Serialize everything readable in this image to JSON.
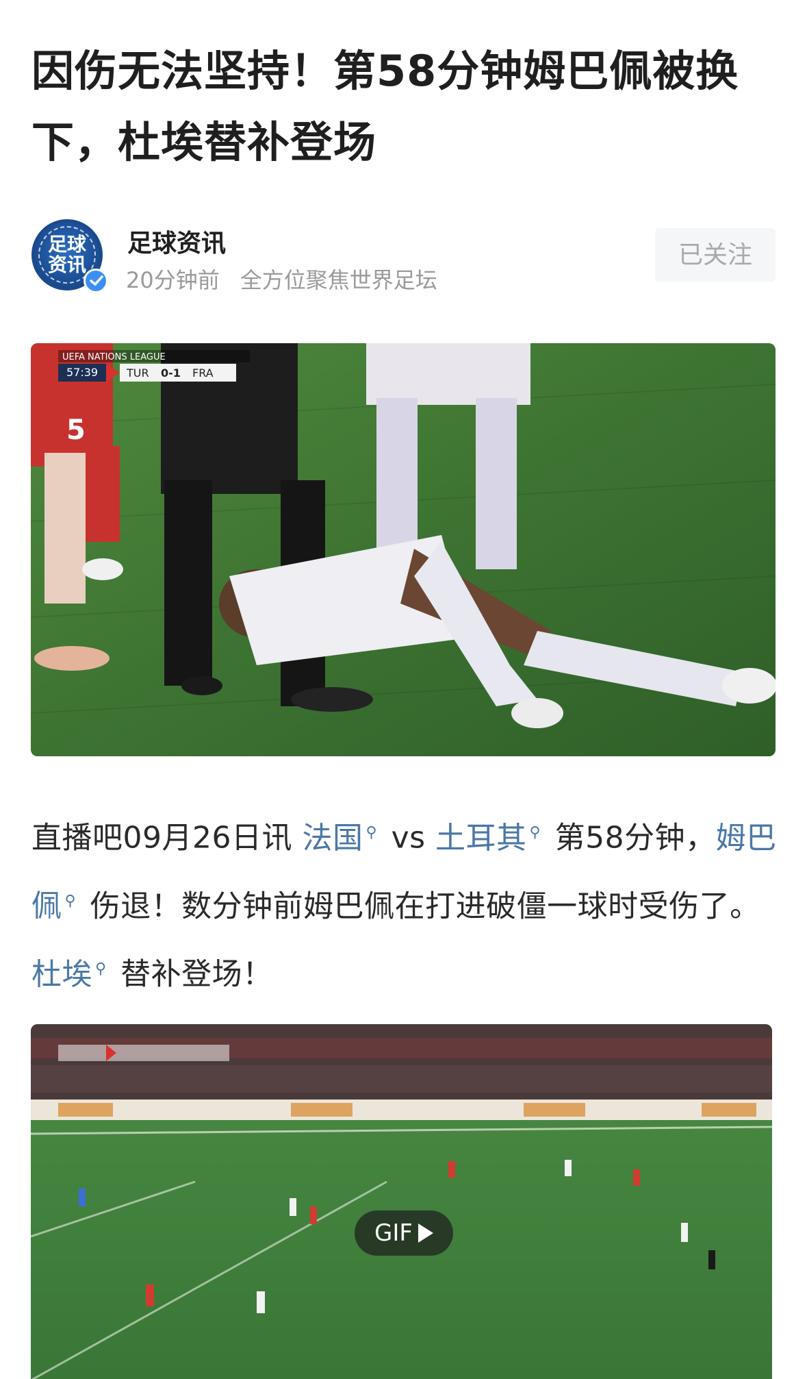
{
  "article": {
    "title": "因伤无法坚持！第58分钟姆巴佩被换下，杜埃替补登场"
  },
  "author": {
    "avatar_text_line1": "足球",
    "avatar_text_line2": "资讯",
    "name": "足球资讯",
    "time": "20分钟前",
    "tagline": "全方位聚焦世界足坛",
    "follow_label": "已关注",
    "verified_icon": "verified-check-icon"
  },
  "image_main": {
    "scorebug_league": "UEFA NATIONS LEAGUE",
    "scorebug_time": "57:39",
    "scorebug_home": "TUR",
    "scorebug_score": "0-1",
    "scorebug_away": "FRA",
    "player_number": "5"
  },
  "body": {
    "part1": "直播吧09月26日讯 ",
    "link1": "法国",
    "part2": " vs ",
    "link2": "土耳其",
    "part3": " 第58分钟，",
    "link3": "姆巴佩",
    "part4": " 伤退！数分钟前姆巴佩在打进破僵一球时受伤了。",
    "link4": "杜埃",
    "part5": " 替补登场！",
    "link_icon": "search-icon"
  },
  "gif": {
    "badge_label": "GIF"
  },
  "colors": {
    "link": "#4a78a6",
    "title": "#1f1f1f",
    "meta": "#9a9a9a",
    "follow_bg": "#f5f6f7"
  }
}
